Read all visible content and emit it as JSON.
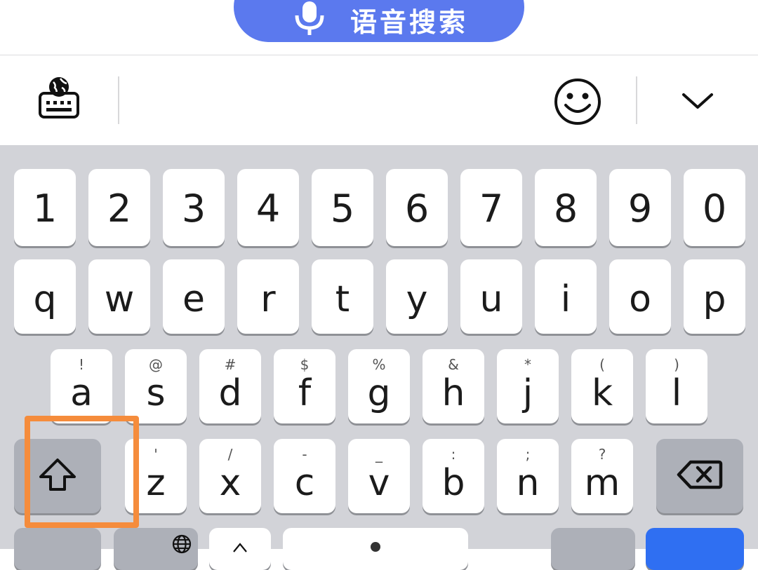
{
  "voice_search": {
    "label": "语音搜索"
  },
  "toolbar": {
    "keyboard_switch_icon": "keyboard-globe-icon",
    "emoji_icon": "smiley-icon",
    "collapse_icon": "chevron-down-icon"
  },
  "keyboard": {
    "number_row": [
      "1",
      "2",
      "3",
      "4",
      "5",
      "6",
      "7",
      "8",
      "9",
      "0"
    ],
    "row1": [
      "q",
      "w",
      "e",
      "r",
      "t",
      "y",
      "u",
      "i",
      "o",
      "p"
    ],
    "row2": [
      {
        "main": "a",
        "sub": "!"
      },
      {
        "main": "s",
        "sub": "@"
      },
      {
        "main": "d",
        "sub": "#"
      },
      {
        "main": "f",
        "sub": "$"
      },
      {
        "main": "g",
        "sub": "%"
      },
      {
        "main": "h",
        "sub": "&"
      },
      {
        "main": "j",
        "sub": "*"
      },
      {
        "main": "k",
        "sub": "("
      },
      {
        "main": "l",
        "sub": ")"
      }
    ],
    "row3": [
      {
        "main": "z",
        "sub": "'"
      },
      {
        "main": "x",
        "sub": "/"
      },
      {
        "main": "c",
        "sub": "-"
      },
      {
        "main": "v",
        "sub": "_"
      },
      {
        "main": "b",
        "sub": ":"
      },
      {
        "main": "n",
        "sub": ";"
      },
      {
        "main": "m",
        "sub": "?"
      }
    ],
    "shift_icon": "shift-arrow-icon",
    "backspace_icon": "backspace-icon",
    "globe_icon": "globe-icon"
  },
  "colors": {
    "voice_button": "#5b79ee",
    "keyboard_bg": "#d2d3d8",
    "key_bg": "#ffffff",
    "function_key_bg": "#adb0b8",
    "enter_key_bg": "#2f6ff2",
    "highlight": "#f58c3c"
  }
}
